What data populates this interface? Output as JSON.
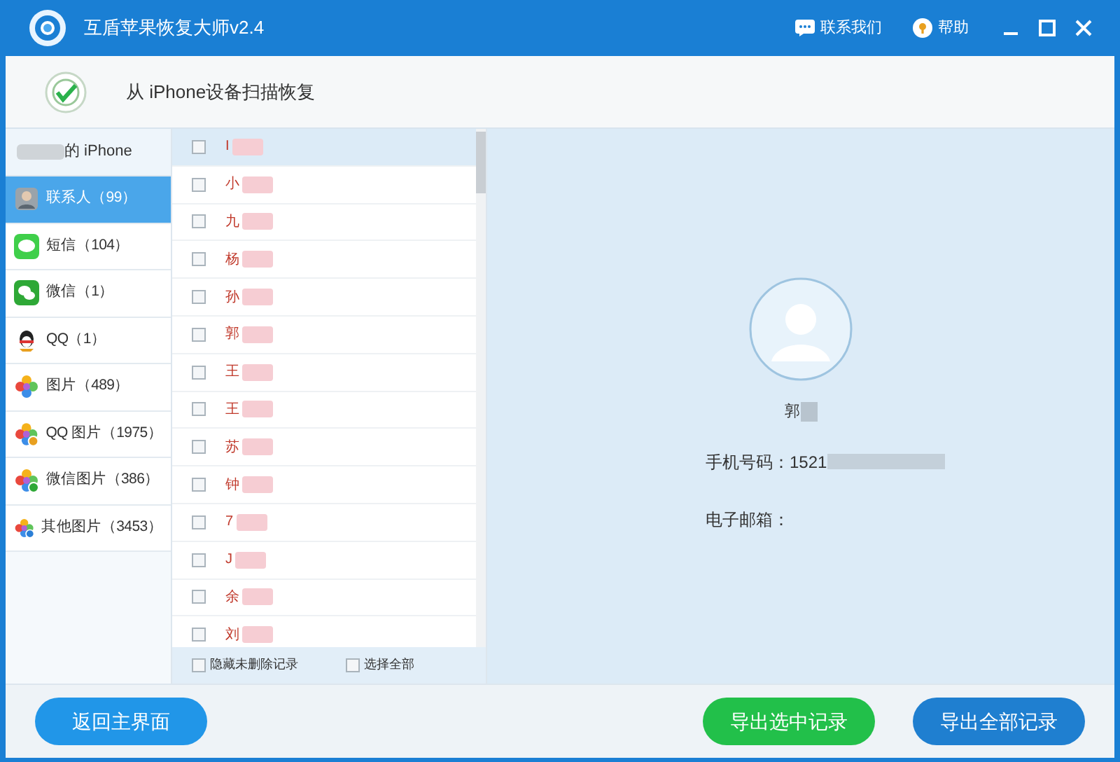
{
  "window": {
    "title": "互盾苹果恢复大师v2.4",
    "contact_us": "联系我们",
    "help": "帮助"
  },
  "header": {
    "title": "从 iPhone设备扫描恢复"
  },
  "device": {
    "name": "的 iPhone"
  },
  "sidebar": [
    {
      "label": "联系人（99）",
      "kind": "contacts",
      "selected": true
    },
    {
      "label": "短信（104）",
      "kind": "sms",
      "selected": false
    },
    {
      "label": "微信（1）",
      "kind": "wechat",
      "selected": false
    },
    {
      "label": "QQ（1）",
      "kind": "qq",
      "selected": false
    },
    {
      "label": "图片（489）",
      "kind": "photos",
      "selected": false
    },
    {
      "label": "QQ 图片（1975）",
      "kind": "qqphotos",
      "selected": false
    },
    {
      "label": "微信图片（386）",
      "kind": "wechatphotos",
      "selected": false
    },
    {
      "label": "其他图片（3453）",
      "kind": "otherphotos",
      "selected": false
    }
  ],
  "contacts": [
    {
      "name": "I",
      "checked": false,
      "selected": true
    },
    {
      "name": "小",
      "checked": false,
      "selected": false
    },
    {
      "name": "九",
      "checked": false,
      "selected": false
    },
    {
      "name": "杨",
      "checked": false,
      "selected": false
    },
    {
      "name": "孙",
      "checked": false,
      "selected": false
    },
    {
      "name": "郭",
      "checked": false,
      "selected": false
    },
    {
      "name": "王",
      "checked": false,
      "selected": false
    },
    {
      "name": "王",
      "checked": false,
      "selected": false
    },
    {
      "name": "苏",
      "checked": false,
      "selected": false
    },
    {
      "name": "钟",
      "checked": false,
      "selected": false
    },
    {
      "name": "7",
      "checked": false,
      "selected": false
    },
    {
      "name": "J",
      "checked": false,
      "selected": false
    },
    {
      "name": "余",
      "checked": false,
      "selected": false
    },
    {
      "name": "刘",
      "checked": false,
      "selected": false
    }
  ],
  "list_footer": {
    "hide_undeleted": {
      "label": "隐藏未删除记录",
      "checked": false
    },
    "select_all": {
      "label": "选择全部",
      "checked": false
    }
  },
  "detail": {
    "name": "郭",
    "phone_label": "手机号码：",
    "phone": "1521",
    "email_label": "电子邮箱："
  },
  "buttons": {
    "back": "返回主界面",
    "export_selected": "导出选中记录",
    "export_all": "导出全部记录"
  }
}
